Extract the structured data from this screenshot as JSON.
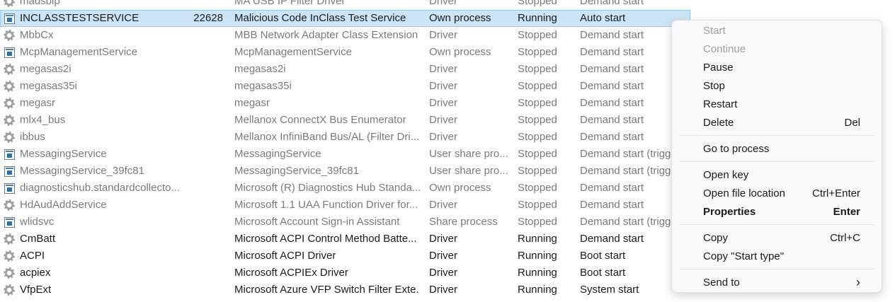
{
  "services": [
    {
      "name": "madsbip",
      "pid": "",
      "description": "MA  USB IP Filter Driver",
      "group": "Driver",
      "status": "Stopped",
      "start_type": "Demand start",
      "icon": "gear-icon",
      "running": false
    },
    {
      "name": "INCLASSTESTSERVICE",
      "pid": "22628",
      "description": "Malicious Code InClass Test Service",
      "group": "Own process",
      "status": "Running",
      "start_type": "Auto start",
      "icon": "service-icon",
      "running": true,
      "selected": true
    },
    {
      "name": "MbbCx",
      "pid": "",
      "description": "MBB Network Adapter Class Extension",
      "group": "Driver",
      "status": "Stopped",
      "start_type": "Demand start",
      "icon": "gear-icon",
      "running": false
    },
    {
      "name": "McpManagementService",
      "pid": "",
      "description": "McpManagementService",
      "group": "Own process",
      "status": "Stopped",
      "start_type": "Demand start",
      "icon": "service-icon",
      "running": false
    },
    {
      "name": "megasas2i",
      "pid": "",
      "description": "megasas2i",
      "group": "Driver",
      "status": "Stopped",
      "start_type": "Demand start",
      "icon": "gear-icon",
      "running": false
    },
    {
      "name": "megasas35i",
      "pid": "",
      "description": "megasas35i",
      "group": "Driver",
      "status": "Stopped",
      "start_type": "Demand start",
      "icon": "gear-icon",
      "running": false
    },
    {
      "name": "megasr",
      "pid": "",
      "description": "megasr",
      "group": "Driver",
      "status": "Stopped",
      "start_type": "Demand start",
      "icon": "gear-icon",
      "running": false
    },
    {
      "name": "mlx4_bus",
      "pid": "",
      "description": "Mellanox ConnectX Bus Enumerator",
      "group": "Driver",
      "status": "Stopped",
      "start_type": "Demand start",
      "icon": "gear-icon",
      "running": false
    },
    {
      "name": "ibbus",
      "pid": "",
      "description": "Mellanox InfiniBand Bus/AL (Filter Dri...",
      "group": "Driver",
      "status": "Stopped",
      "start_type": "Demand start",
      "icon": "gear-icon",
      "running": false
    },
    {
      "name": "MessagingService",
      "pid": "",
      "description": "MessagingService",
      "group": "User share pro...",
      "status": "Stopped",
      "start_type": "Demand start (trigg",
      "icon": "service-icon",
      "running": false
    },
    {
      "name": "MessagingService_39fc81",
      "pid": "",
      "description": "MessagingService_39fc81",
      "group": "User share pro...",
      "status": "Stopped",
      "start_type": "Demand start (trigg",
      "icon": "service-icon",
      "running": false
    },
    {
      "name": "diagnosticshub.standardcollecto...",
      "pid": "",
      "description": "Microsoft (R) Diagnostics Hub Standa...",
      "group": "Own process",
      "status": "Stopped",
      "start_type": "Demand start",
      "icon": "service-icon",
      "running": false
    },
    {
      "name": "HdAudAddService",
      "pid": "",
      "description": "Microsoft 1.1 UAA Function Driver for...",
      "group": "Driver",
      "status": "Stopped",
      "start_type": "Demand start",
      "icon": "gear-icon",
      "running": false
    },
    {
      "name": "wlidsvc",
      "pid": "",
      "description": "Microsoft Account Sign-in Assistant",
      "group": "Share process",
      "status": "Stopped",
      "start_type": "Demand start (trigg",
      "icon": "service-icon",
      "running": false
    },
    {
      "name": "CmBatt",
      "pid": "",
      "description": "Microsoft ACPI Control Method Batte...",
      "group": "Driver",
      "status": "Running",
      "start_type": "Demand start",
      "icon": "gear-icon",
      "running": true
    },
    {
      "name": "ACPI",
      "pid": "",
      "description": "Microsoft ACPI Driver",
      "group": "Driver",
      "status": "Running",
      "start_type": "Boot start",
      "icon": "gear-icon",
      "running": true
    },
    {
      "name": "acpiex",
      "pid": "",
      "description": "Microsoft ACPIEx Driver",
      "group": "Driver",
      "status": "Running",
      "start_type": "Boot start",
      "icon": "gear-icon",
      "running": true
    },
    {
      "name": "VfpExt",
      "pid": "",
      "description": "Microsoft Azure VFP Switch Filter Exte...",
      "group": "Driver",
      "status": "Running",
      "start_type": "System start",
      "icon": "gear-icon",
      "running": true
    }
  ],
  "context_menu": {
    "start": "Start",
    "continue": "Continue",
    "pause": "Pause",
    "stop": "Stop",
    "restart": "Restart",
    "delete": "Delete",
    "delete_shortcut": "Del",
    "go_to_process": "Go to process",
    "open_key": "Open key",
    "open_file_location": "Open file location",
    "open_file_location_shortcut": "Ctrl+Enter",
    "properties": "Properties",
    "properties_shortcut": "Enter",
    "copy": "Copy",
    "copy_shortcut": "Ctrl+C",
    "copy_start_type": "Copy \"Start type\"",
    "send_to": "Send to",
    "submenu_arrow": "›"
  }
}
